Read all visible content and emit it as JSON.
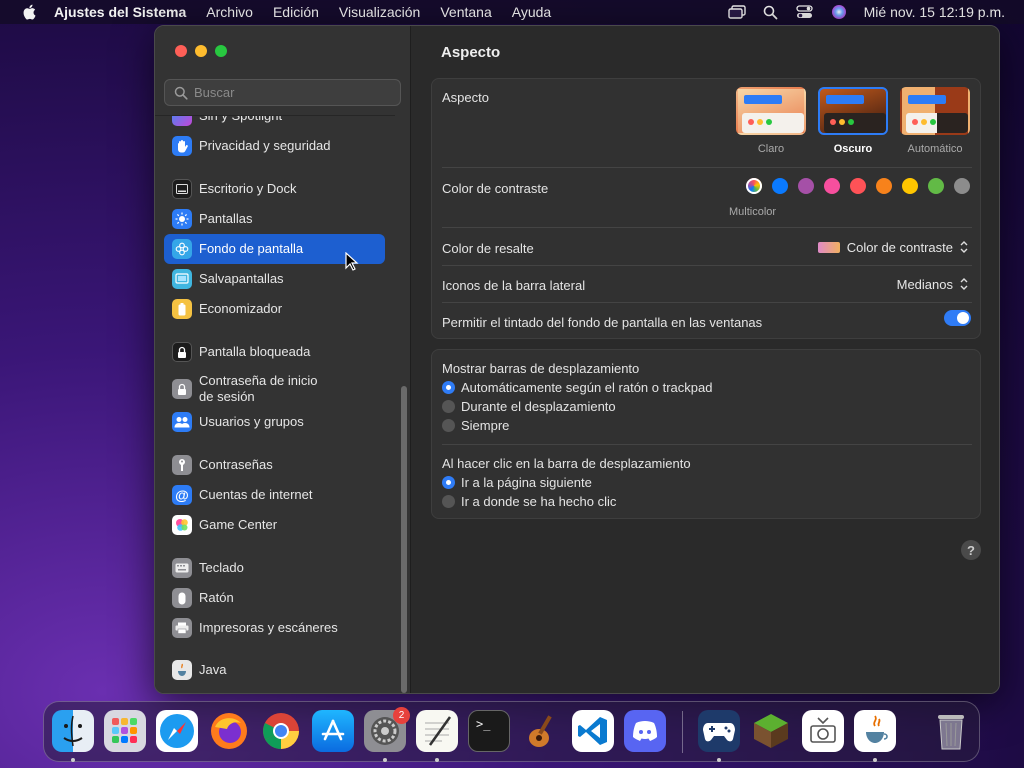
{
  "menubar": {
    "app_name": "Ajustes del Sistema",
    "menus": [
      "Archivo",
      "Edición",
      "Visualización",
      "Ventana",
      "Ayuda"
    ],
    "clock": "Mié nov. 15  12:19 p.m."
  },
  "sidebar": {
    "search_placeholder": "Buscar",
    "items": [
      {
        "label": "Siri y Spotlight",
        "icon": "siri-icon",
        "color": "#8a5cf0"
      },
      {
        "label": "Privacidad y seguridad",
        "icon": "hand-icon",
        "color": "#2d7cf6"
      },
      {
        "label": "Escritorio y Dock",
        "icon": "dock-icon",
        "color": "#1c1c1c"
      },
      {
        "label": "Pantallas",
        "icon": "sun-icon",
        "color": "#2d7cf6"
      },
      {
        "label": "Fondo de pantalla",
        "icon": "flower-icon",
        "color": "#35a6e8"
      },
      {
        "label": "Salvapantallas",
        "icon": "screensaver-icon",
        "color": "#40b6e0"
      },
      {
        "label": "Economizador",
        "icon": "battery-icon",
        "color": "#f5c242"
      },
      {
        "label": "Pantalla bloqueada",
        "icon": "lock-icon",
        "color": "#1c1c1c"
      },
      {
        "label": "Contraseña de inicio\nde sesión",
        "icon": "lock-gray-icon",
        "color": "#8e8e93"
      },
      {
        "label": "Usuarios y grupos",
        "icon": "users-icon",
        "color": "#2d7cf6"
      },
      {
        "label": "Contraseñas",
        "icon": "key-icon",
        "color": "#8e8e93"
      },
      {
        "label": "Cuentas de internet",
        "icon": "at-icon",
        "color": "#2d7cf6"
      },
      {
        "label": "Game Center",
        "icon": "game-center-icon",
        "color": "#ffffff"
      },
      {
        "label": "Teclado",
        "icon": "keyboard-icon",
        "color": "#8e8e93"
      },
      {
        "label": "Ratón",
        "icon": "mouse-icon",
        "color": "#8e8e93"
      },
      {
        "label": "Impresoras y escáneres",
        "icon": "printer-icon",
        "color": "#8e8e93"
      },
      {
        "label": "Java",
        "icon": "java-icon",
        "color": "#e8e8e8"
      }
    ],
    "selected": "Fondo de pantalla"
  },
  "main": {
    "title": "Aspecto",
    "appearance": {
      "label": "Aspecto",
      "options": [
        "Claro",
        "Oscuro",
        "Automático"
      ],
      "selected": "Oscuro"
    },
    "accent": {
      "label": "Color de contraste",
      "caption": "Multicolor",
      "colors": [
        "multicolor",
        "#0a7aff",
        "#a550a7",
        "#f74f9e",
        "#ff5257",
        "#f7821b",
        "#ffc600",
        "#62ba46",
        "#8c8c8c"
      ],
      "selected": "multicolor"
    },
    "highlight": {
      "label": "Color de resalte",
      "value": "Color de contraste"
    },
    "sidebar_icons": {
      "label": "Iconos de la barra lateral",
      "value": "Medianos"
    },
    "tinting": {
      "label": "Permitir el tintado del fondo de pantalla en las ventanas",
      "enabled": true
    },
    "scrollbars": {
      "label": "Mostrar barras de desplazamiento",
      "options": [
        "Automáticamente según el ratón o trackpad",
        "Durante el desplazamiento",
        "Siempre"
      ],
      "selected": 0
    },
    "click_scroll": {
      "label": "Al hacer clic en la barra de desplazamiento",
      "options": [
        "Ir a la página siguiente",
        "Ir a donde se ha hecho clic"
      ],
      "selected": 0
    },
    "help": "?"
  },
  "dock": {
    "apps": [
      "Finder",
      "Launchpad",
      "Safari",
      "Firefox",
      "Chrome",
      "App Store",
      "Ajustes del Sistema",
      "TextEdit",
      "Terminal",
      "GarageBand",
      "Visual Studio Code",
      "Discord",
      "Steam Link",
      "Minecraft",
      "Captura",
      "Java",
      "Papelera"
    ],
    "settings_badge": "2"
  }
}
